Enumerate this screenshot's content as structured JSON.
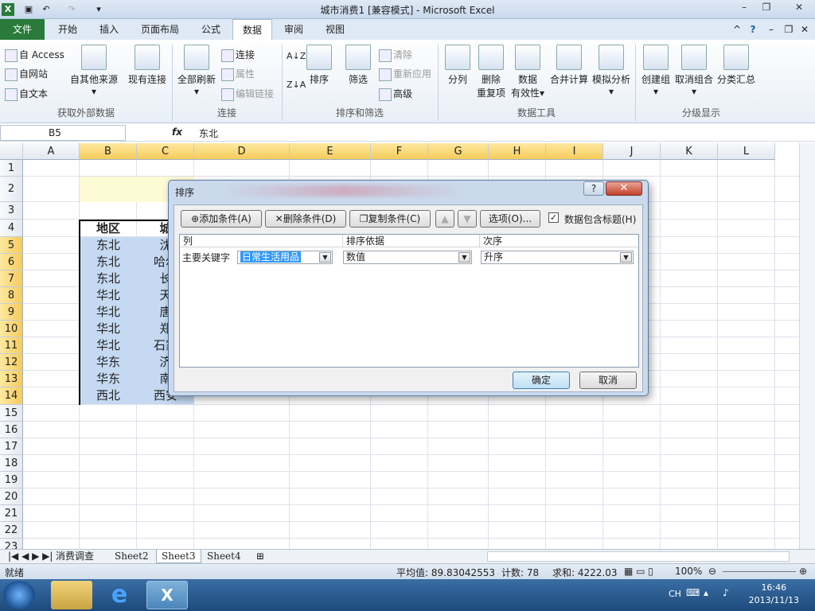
{
  "window": {
    "title": "城市消费1 [兼容模式] - Microsoft Excel"
  },
  "tabs": [
    "文件",
    "开始",
    "插入",
    "页面布局",
    "公式",
    "数据",
    "审阅",
    "视图"
  ],
  "ribbon": {
    "ext": {
      "access": "自 Access",
      "web": "自网站",
      "text": "自文本",
      "other": "自其他来源",
      "existing": "现有连接",
      "group": "获取外部数据"
    },
    "conn": {
      "refresh": "全部刷新",
      "connect": "连接",
      "props": "属性",
      "edit_links": "编辑链接",
      "group": "连接"
    },
    "sort": {
      "sort": "排序",
      "filter": "筛选",
      "clear": "清除",
      "reapply": "重新应用",
      "advanced": "高级",
      "group": "排序和筛选"
    },
    "tools": {
      "split": "分列",
      "remove_dup_1": "删除",
      "remove_dup_2": "重复项",
      "validate_1": "数据",
      "validate_2": "有效性",
      "consolidate": "合并计算",
      "whatif": "模拟分析",
      "group": "数据工具"
    },
    "outline": {
      "group_btn": "创建组",
      "ungroup": "取消组合",
      "subtotal": "分类汇总",
      "group": "分级显示"
    }
  },
  "formula_bar": {
    "name_box": "B5",
    "fx": "fx",
    "value": "东北"
  },
  "columns": [
    "A",
    "B",
    "C",
    "D",
    "E",
    "F",
    "G",
    "H",
    "I",
    "J",
    "K",
    "L"
  ],
  "rows": [
    "1",
    "2",
    "3",
    "4",
    "5",
    "6",
    "7",
    "8",
    "9",
    "10",
    "11",
    "12",
    "13",
    "14",
    "15",
    "16",
    "17",
    "18",
    "19",
    "20",
    "21",
    "22",
    "23"
  ],
  "cells": {
    "B4": "地区",
    "C4": "城",
    "B": [
      "东北",
      "东北",
      "东北",
      "华北",
      "华北",
      "华北",
      "华北",
      "华东",
      "华东",
      "西北"
    ],
    "C": [
      "沈",
      "哈尔",
      "长",
      "天",
      "唐",
      "郑",
      "石家",
      "济",
      "南",
      "西安"
    ]
  },
  "sheets": [
    "消费调查",
    "Sheet2",
    "Sheet3",
    "Sheet4"
  ],
  "active_sheet": "Sheet3",
  "status": {
    "ready": "就绪",
    "avg": "平均值: 89.83042553",
    "count": "计数: 78",
    "sum": "求和: 4222.03",
    "zoom": "100%"
  },
  "taskbar": {
    "lang": "CH",
    "time": "16:46",
    "date": "2013/11/13"
  },
  "dialog": {
    "title": "排序",
    "help": "?",
    "close": "✕",
    "add": "添加条件(A)",
    "delete": "删除条件(D)",
    "copy": "复制条件(C)",
    "options": "选项(O)...",
    "has_header": "数据包含标题(H)",
    "has_header_checked": true,
    "col_header": "列",
    "sorton_header": "排序依据",
    "order_header": "次序",
    "row_label": "主要关键字",
    "key_value": "日常生活用品",
    "sorton_value": "数值",
    "order_value": "升序",
    "ok": "确定",
    "cancel": "取消"
  }
}
